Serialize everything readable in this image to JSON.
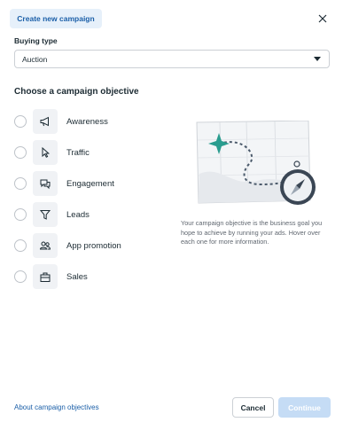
{
  "header": {
    "tab_label": "Create new campaign",
    "close_icon": "close-icon"
  },
  "buying_type": {
    "label": "Buying type",
    "selected": "Auction"
  },
  "objectives": {
    "heading": "Choose a campaign objective",
    "items": [
      {
        "label": "Awareness",
        "icon": "megaphone-icon"
      },
      {
        "label": "Traffic",
        "icon": "cursor-icon"
      },
      {
        "label": "Engagement",
        "icon": "chat-bubbles-icon"
      },
      {
        "label": "Leads",
        "icon": "funnel-icon"
      },
      {
        "label": "App promotion",
        "icon": "people-icon"
      },
      {
        "label": "Sales",
        "icon": "shopping-bag-icon"
      }
    ]
  },
  "info": {
    "description": "Your campaign objective is the business goal you hope to achieve by running your ads. Hover over each one for more information."
  },
  "footer": {
    "about_link": "About campaign objectives",
    "cancel_label": "Cancel",
    "continue_label": "Continue"
  },
  "colors": {
    "accent": "#1b5fa8",
    "accent_light": "#e6f0fa",
    "disabled_primary": "#c5dcf5",
    "map_teal": "#2a9d8f"
  }
}
